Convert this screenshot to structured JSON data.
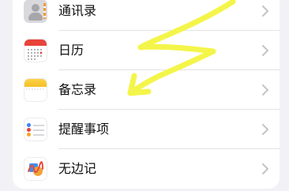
{
  "list": {
    "items": [
      {
        "label": "通讯录",
        "icon": "contacts-icon"
      },
      {
        "label": "日历",
        "icon": "calendar-icon"
      },
      {
        "label": "备忘录",
        "icon": "notes-icon"
      },
      {
        "label": "提醒事项",
        "icon": "reminders-icon"
      },
      {
        "label": "无边记",
        "icon": "freeform-icon"
      }
    ]
  },
  "colors": {
    "background": "#f2f2f6",
    "annotation_arrow": "#f4f54a",
    "calendar_red": "#e8433a",
    "notes_yellow": "#f5c024"
  }
}
